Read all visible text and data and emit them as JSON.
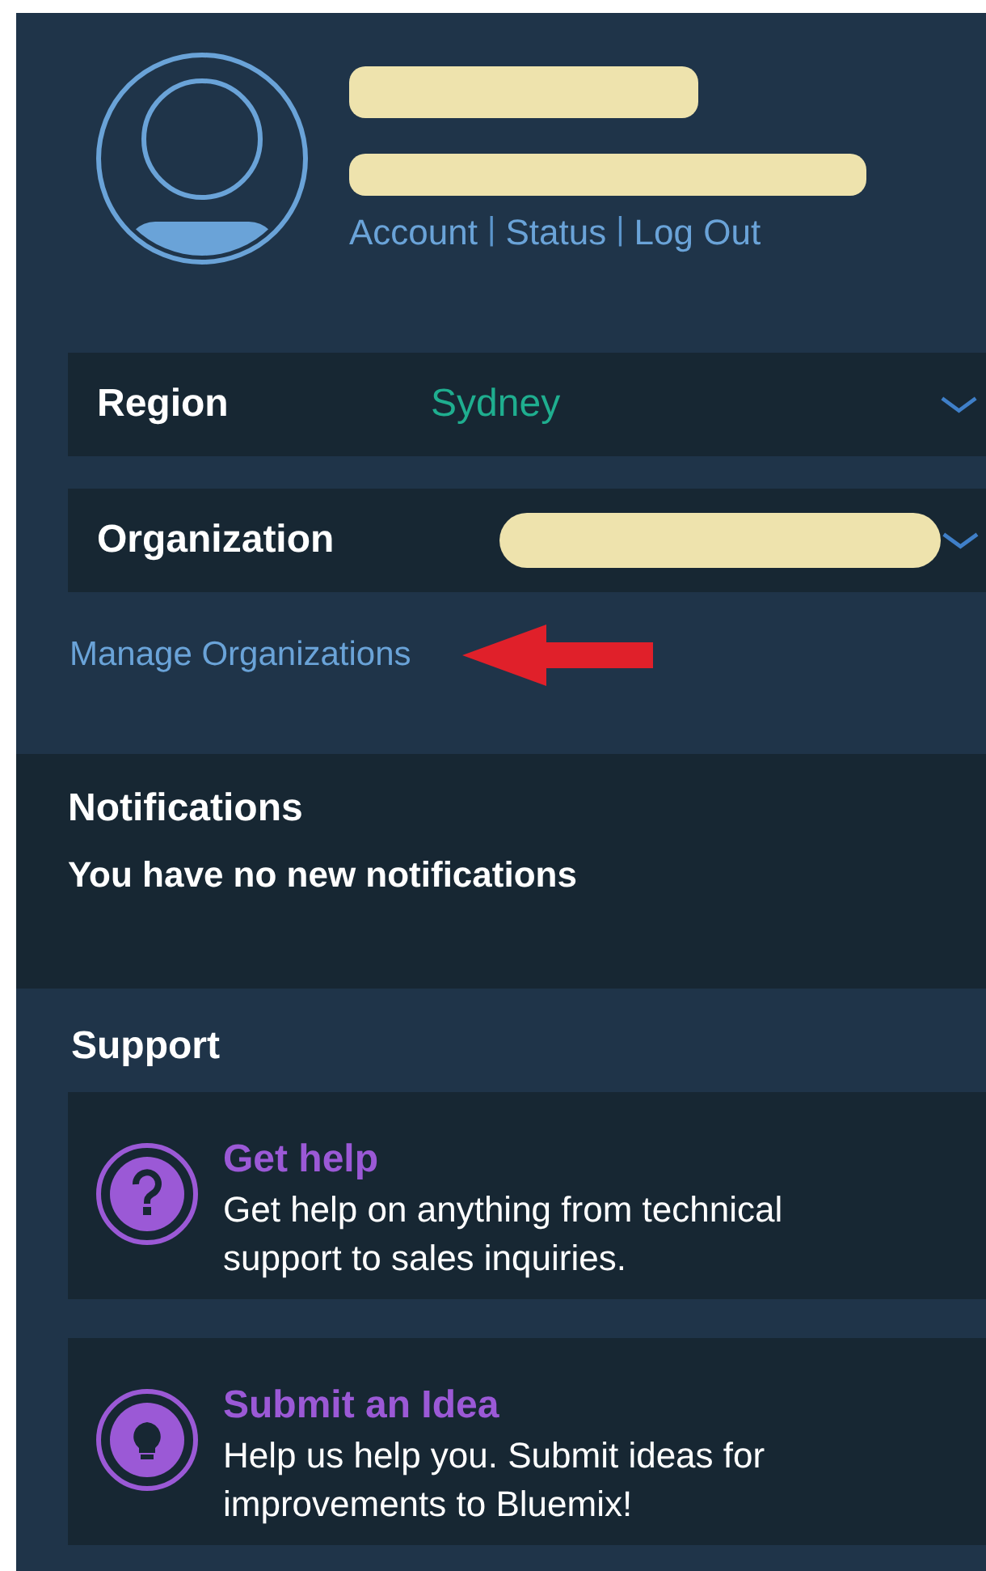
{
  "profile": {
    "links": [
      {
        "kind": "link",
        "text": "Account"
      },
      {
        "kind": "separator",
        "text": "|"
      },
      {
        "kind": "link",
        "text": "Status"
      },
      {
        "kind": "separator",
        "text": "|"
      },
      {
        "kind": "link",
        "text": "Log Out"
      }
    ]
  },
  "selectors": [
    {
      "label": "Region",
      "value": "Sydney",
      "redacted": false
    },
    {
      "label": "Organization",
      "redacted": true
    }
  ],
  "manage_link": "Manage Organizations",
  "notifications": {
    "title": "Notifications",
    "message": "You have no new notifications"
  },
  "support": {
    "title": "Support",
    "cards": [
      {
        "kind": "help",
        "title": "Get help",
        "text": "Get help on anything from technical support to sales inquiries."
      },
      {
        "kind": "idea",
        "title": "Submit an Idea",
        "text": "Help us help you. Submit ideas for improvements to Bluemix!"
      }
    ]
  }
}
